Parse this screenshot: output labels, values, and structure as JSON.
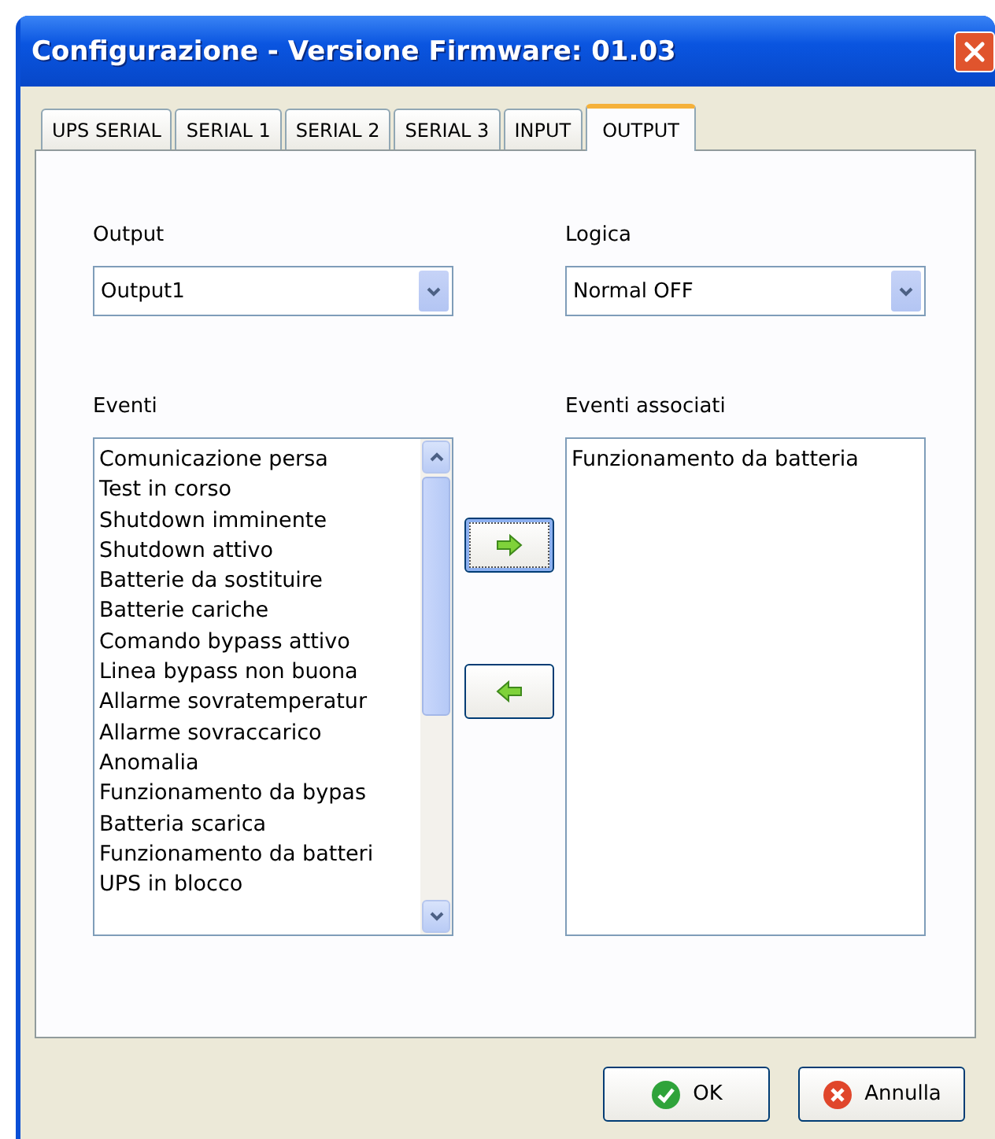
{
  "window": {
    "title": "Configurazione - Versione Firmware: 01.03"
  },
  "tabs": [
    {
      "label": "UPS SERIAL",
      "selected": false
    },
    {
      "label": "SERIAL 1",
      "selected": false
    },
    {
      "label": "SERIAL 2",
      "selected": false
    },
    {
      "label": "SERIAL 3",
      "selected": false
    },
    {
      "label": "INPUT",
      "selected": false
    },
    {
      "label": "OUTPUT",
      "selected": true
    }
  ],
  "output": {
    "label": "Output",
    "value": "Output1"
  },
  "logica": {
    "label": "Logica",
    "value": "Normal OFF"
  },
  "eventi": {
    "label": "Eventi",
    "items": [
      "Comunicazione persa",
      "Test in corso",
      "Shutdown imminente",
      "Shutdown attivo",
      "Batterie da sostituire",
      "Batterie cariche",
      "Comando bypass attivo",
      "Linea bypass non buona",
      "Allarme sovratemperatur",
      "Allarme sovraccarico",
      "Anomalia",
      "Funzionamento da bypas",
      "Batteria scarica",
      "Funzionamento da batteri",
      "UPS in blocco"
    ]
  },
  "eventi_associati": {
    "label": "Eventi associati",
    "items": [
      "Funzionamento da batteria"
    ]
  },
  "buttons": [
    {
      "label": "OK",
      "kind": "ok"
    },
    {
      "label": "Annulla",
      "kind": "cancel"
    }
  ]
}
